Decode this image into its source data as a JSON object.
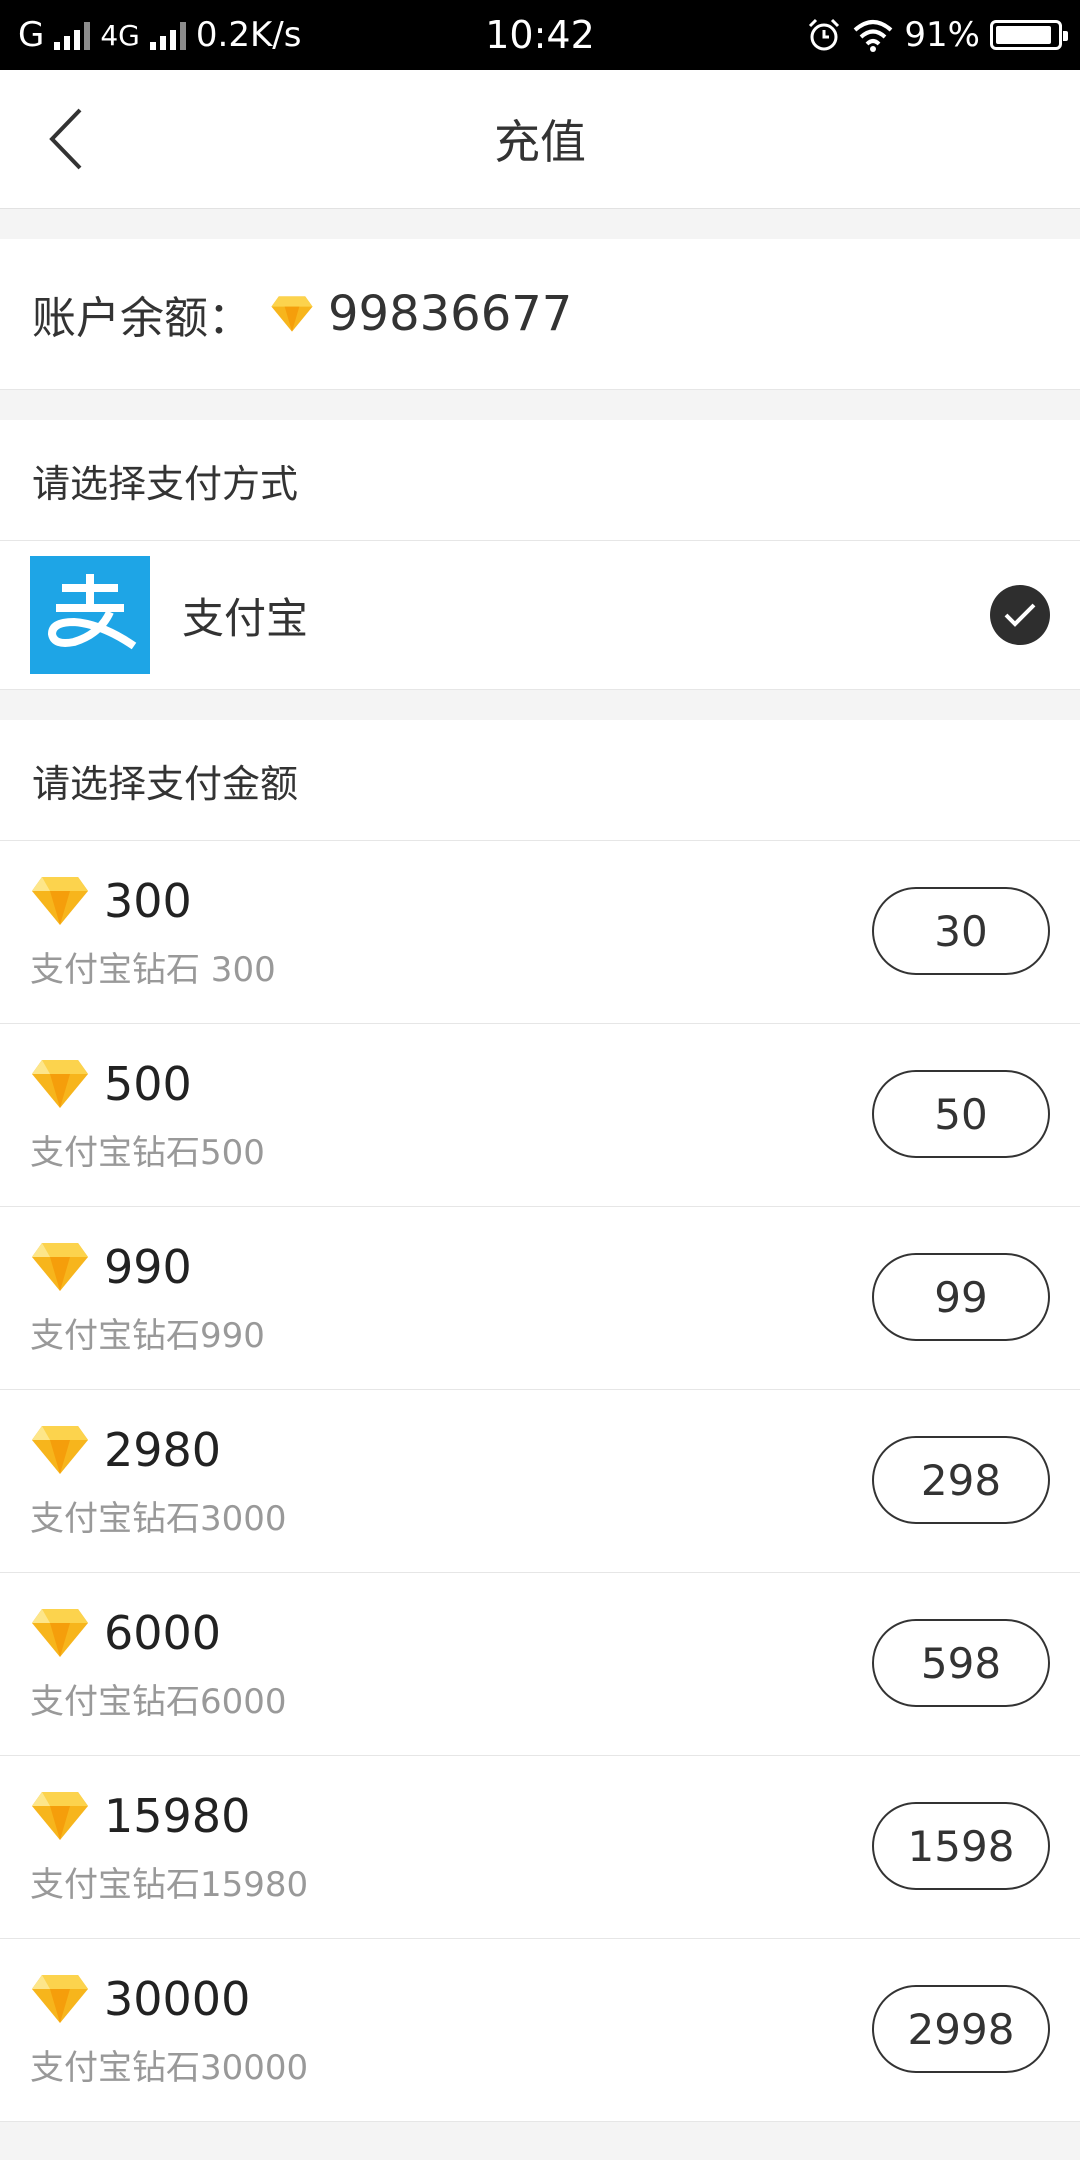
{
  "status_bar": {
    "carrier1": "G",
    "network": "4G",
    "speed": "0.2K/s",
    "time": "10:42",
    "battery": "91%",
    "battery_level": 0.91
  },
  "header": {
    "title": "充值"
  },
  "balance": {
    "label": "账户余额：",
    "value": "99836677"
  },
  "payment": {
    "heading": "请选择支付方式",
    "method": {
      "name": "支付宝",
      "icon": "alipay-icon",
      "selected": true
    }
  },
  "amounts": {
    "heading": "请选择支付金额",
    "items": [
      {
        "diamonds": "300",
        "desc": "支付宝钻石 300",
        "price": "30"
      },
      {
        "diamonds": "500",
        "desc": "支付宝钻石500",
        "price": "50"
      },
      {
        "diamonds": "990",
        "desc": "支付宝钻石990",
        "price": "99"
      },
      {
        "diamonds": "2980",
        "desc": "支付宝钻石3000",
        "price": "298"
      },
      {
        "diamonds": "6000",
        "desc": "支付宝钻石6000",
        "price": "598"
      },
      {
        "diamonds": "15980",
        "desc": "支付宝钻石15980",
        "price": "1598"
      },
      {
        "diamonds": "30000",
        "desc": "支付宝钻石30000",
        "price": "2998"
      }
    ]
  },
  "colors": {
    "alipay_blue": "#1ea5e6",
    "diamond": "#f7b51c",
    "check_bg": "#2e2e2e"
  }
}
